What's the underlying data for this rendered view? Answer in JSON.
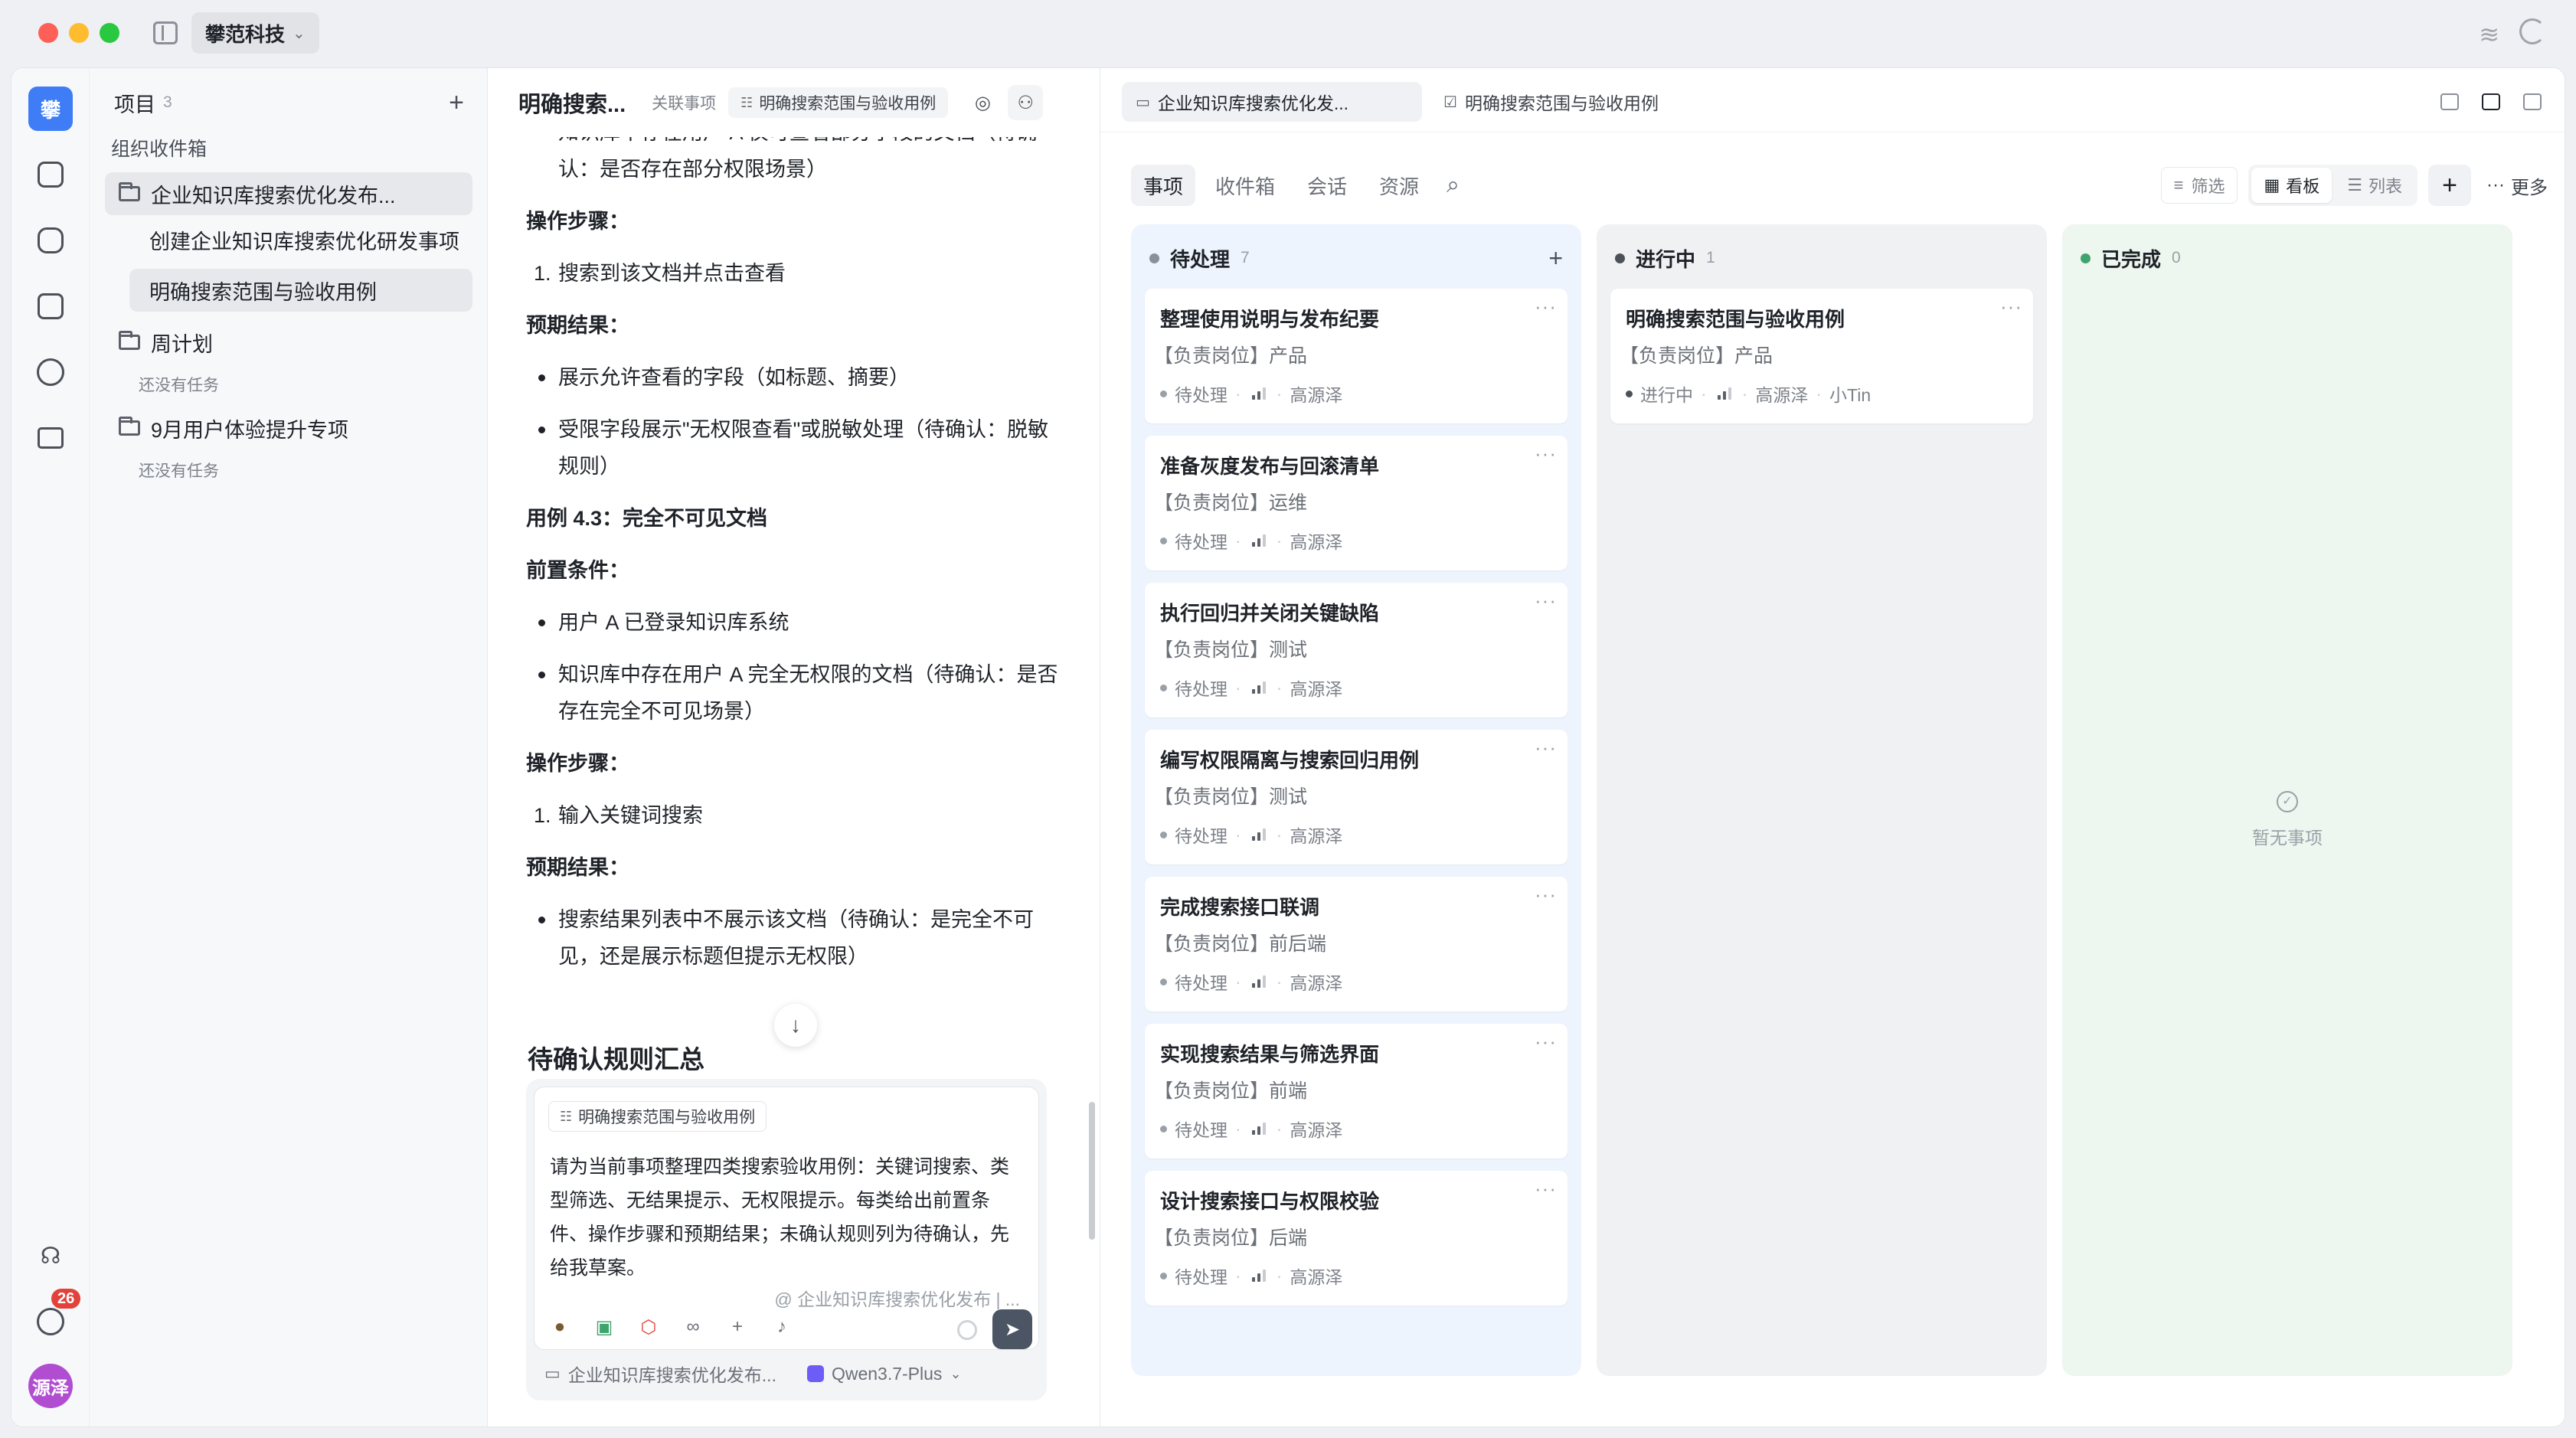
{
  "titlebar": {
    "workspace": "攀范科技"
  },
  "rail": {
    "logo": "攀",
    "icons": [
      "home-icon",
      "chat-icon",
      "agent-icon",
      "list-icon",
      "folder-icon"
    ],
    "bottom_icons": [
      "headset-icon",
      "inbox-icon"
    ],
    "badge": "26",
    "avatar": "源泽"
  },
  "sidebar": {
    "title": "项目",
    "count": "3",
    "section": "组织收件箱",
    "projects": [
      {
        "label": "企业知识库搜索优化发布...",
        "children": [
          "创建企业知识库搜索优化研发事项",
          "明确搜索范围与验收用例"
        ]
      },
      {
        "label": "周计划",
        "empty": "还没有任务"
      },
      {
        "label": "9月用户体验提升专项",
        "empty": "还没有任务"
      }
    ]
  },
  "doc": {
    "title": "明确搜索...",
    "related_label": "关联事项",
    "related_chip": "明确搜索范围与验收用例",
    "lines": [
      "知识库中存在用户 A 仅可查看部分字段的文档（待确认：是否存在部分权限场景）",
      "操作步骤：",
      "搜索到该文档并点击查看",
      "预期结果：",
      "展示允许查看的字段（如标题、摘要）",
      "受限字段展示\"无权限查看\"或脱敏处理（待确认：脱敏规则）",
      "用例 4.3：完全不可见文档",
      "前置条件：",
      "用户 A 已登录知识库系统",
      "知识库中存在用户 A 完全无权限的文档（待确认：是否存在完全不可见场景）",
      "操作步骤：",
      "输入关键词搜索",
      "预期结果：",
      "搜索结果列表中不展示该文档（待确认：是完全不可见，还是展示标题但提示无权限）"
    ],
    "heading": "待确认规则汇总",
    "composer": {
      "chip": "明确搜索范围与验收用例",
      "text": "请为当前事项整理四类搜索验收用例：关键词搜索、类型筛选、无结果提示、无权限提示。每类给出前置条件、操作步骤和预期结果；未确认规则列为待确认，先给我草案。",
      "context": "@ 企业知识库搜索优化发布 | ...",
      "folder": "企业知识库搜索优化发布...",
      "model": "Qwen3.7-Plus"
    }
  },
  "board": {
    "tabs": [
      "企业知识库搜索优化发...",
      "明确搜索范围与验收用例"
    ],
    "subtabs": [
      "事项",
      "收件箱",
      "会话",
      "资源"
    ],
    "filter": "筛选",
    "view_board": "看板",
    "view_list": "列表",
    "more": "更多",
    "columns": [
      {
        "title": "待处理",
        "count": "7",
        "color": "#8a8f99",
        "cards": [
          {
            "title": "整理使用说明与发布纪要",
            "role": "【负责岗位】产品",
            "status": "待处理",
            "owner": "高源泽"
          },
          {
            "title": "准备灰度发布与回滚清单",
            "role": "【负责岗位】运维",
            "status": "待处理",
            "owner": "高源泽"
          },
          {
            "title": "执行回归并关闭关键缺陷",
            "role": "【负责岗位】测试",
            "status": "待处理",
            "owner": "高源泽"
          },
          {
            "title": "编写权限隔离与搜索回归用例",
            "role": "【负责岗位】测试",
            "status": "待处理",
            "owner": "高源泽"
          },
          {
            "title": "完成搜索接口联调",
            "role": "【负责岗位】前后端",
            "status": "待处理",
            "owner": "高源泽"
          },
          {
            "title": "实现搜索结果与筛选界面",
            "role": "【负责岗位】前端",
            "status": "待处理",
            "owner": "高源泽"
          },
          {
            "title": "设计搜索接口与权限校验",
            "role": "【负责岗位】后端",
            "status": "待处理",
            "owner": "高源泽"
          }
        ]
      },
      {
        "title": "进行中",
        "count": "1",
        "color": "#4b5059",
        "cards": [
          {
            "title": "明确搜索范围与验收用例",
            "role": "【负责岗位】产品",
            "status": "进行中",
            "owner": "高源泽",
            "assignee": "小Tin"
          }
        ]
      },
      {
        "title": "已完成",
        "count": "0",
        "color": "#3fa46b",
        "empty": "暂无事项"
      }
    ]
  }
}
